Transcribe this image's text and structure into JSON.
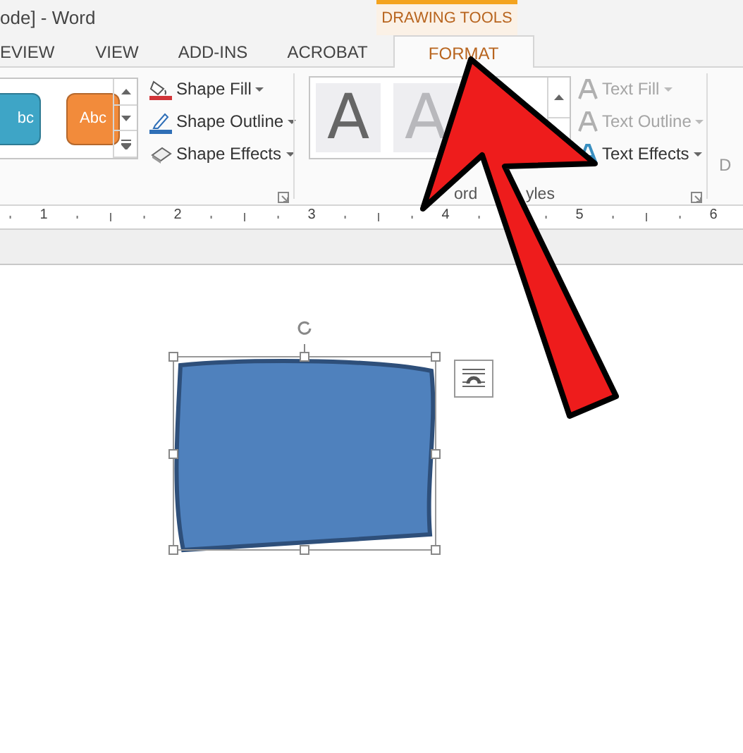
{
  "window": {
    "title": "ode] - Word"
  },
  "contextual_tab_group": "DRAWING TOOLS",
  "tabs": [
    {
      "label": "EVIEW",
      "selected": false
    },
    {
      "label": "VIEW",
      "selected": false
    },
    {
      "label": "ADD-INS",
      "selected": false
    },
    {
      "label": "ACROBAT",
      "selected": false
    },
    {
      "label": "FORMAT",
      "selected": true
    }
  ],
  "shape_styles": [
    {
      "label": "bc",
      "color": "#3ea5c6"
    },
    {
      "label": "Abc",
      "color": "#f28b3b"
    }
  ],
  "shape_commands": [
    {
      "label": "Shape Fill",
      "kind": "fill"
    },
    {
      "label": "Shape Outline",
      "kind": "outline"
    },
    {
      "label": "Shape Effects",
      "kind": "effects"
    }
  ],
  "wordart_styles": [
    {
      "label": "A",
      "kind": "solid"
    },
    {
      "label": "A",
      "kind": "faded"
    }
  ],
  "wordart_group_label": [
    "ord",
    "yles"
  ],
  "text_commands": [
    {
      "label": "Text Fill",
      "disabled": true
    },
    {
      "label": "Text Outline",
      "disabled": true
    },
    {
      "label": "Text Effects",
      "disabled": false
    }
  ],
  "next_group_label": "D",
  "ruler": [
    "1",
    "2",
    "3",
    "4",
    "5",
    "6"
  ]
}
